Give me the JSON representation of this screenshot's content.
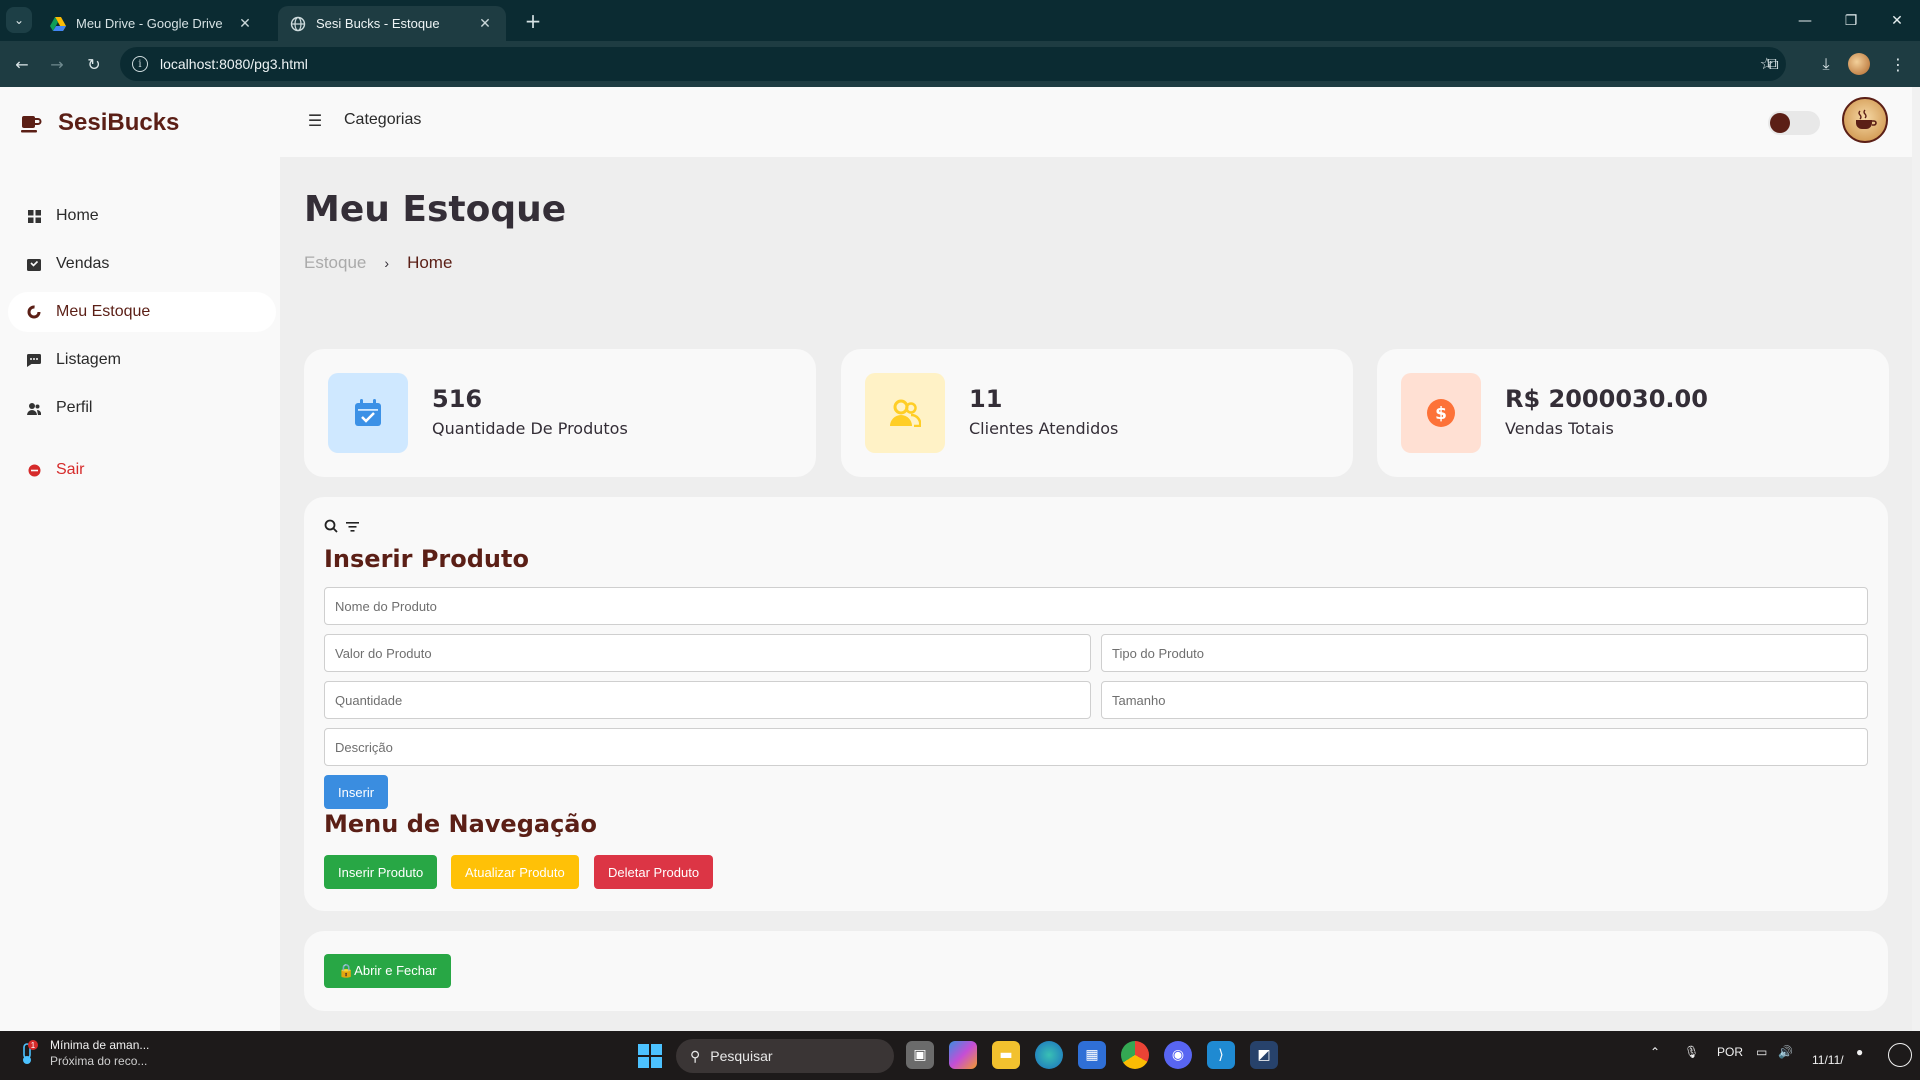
{
  "browser": {
    "tabs": [
      {
        "title": "Meu Drive - Google Drive",
        "active": false
      },
      {
        "title": "Sesi Bucks - Estoque",
        "active": true
      }
    ],
    "url": "localhost:8080/pg3.html"
  },
  "brand": {
    "name": "SesiBucks"
  },
  "sidebar": {
    "items": [
      {
        "label": "Home",
        "icon": "dashboard-icon"
      },
      {
        "label": "Vendas",
        "icon": "shopping-bag-icon"
      },
      {
        "label": "Meu Estoque",
        "icon": "doughnut-chart-icon",
        "active": true
      },
      {
        "label": "Listagem",
        "icon": "message-dots-icon"
      },
      {
        "label": "Perfil",
        "icon": "group-icon"
      }
    ],
    "logout": {
      "label": "Sair",
      "icon": "logout-circle-icon"
    }
  },
  "topbar": {
    "menu_icon": "menu-icon",
    "category_label": "Categorias",
    "theme_toggle_on": true
  },
  "main": {
    "title": "Meu Estoque",
    "breadcrumb": [
      "Estoque",
      "Home"
    ]
  },
  "stats": [
    {
      "value": "516",
      "label": "Quantidade De Produtos",
      "icon": "calendar-check-icon",
      "color": "#3c91e6",
      "bg": "#cfe8ff"
    },
    {
      "value": "11",
      "label": "Clientes Atendidos",
      "icon": "group-icon",
      "color": "#ffce26",
      "bg": "#fff2c6"
    },
    {
      "value": "R$ 2000030.00",
      "label": "Vendas Totais",
      "icon": "dollar-circle-icon",
      "color": "#fd7238",
      "bg": "#ffe0d3"
    }
  ],
  "form": {
    "heading": "Inserir Produto",
    "fields": {
      "nome": {
        "placeholder": "Nome do Produto",
        "value": ""
      },
      "valor": {
        "placeholder": "Valor do Produto",
        "value": ""
      },
      "tipo": {
        "placeholder": "Tipo do Produto",
        "value": ""
      },
      "quantidade": {
        "placeholder": "Quantidade",
        "value": ""
      },
      "tamanho": {
        "placeholder": "Tamanho",
        "value": ""
      },
      "descricao": {
        "placeholder": "Descrição",
        "value": ""
      }
    },
    "submit_label": "Inserir"
  },
  "nav_menu": {
    "heading": "Menu de Navegação",
    "buttons": [
      "Inserir Produto",
      "Atualizar Produto",
      "Deletar Produto"
    ]
  },
  "toggle_panel": {
    "button_label": "🔒Abrir e Fechar"
  },
  "taskbar": {
    "weather_title": "Mínima de aman...",
    "weather_sub": "Próxima do reco...",
    "weather_badge": "1",
    "search_label": "Pesquisar",
    "language": "POR",
    "date": "11/11/"
  },
  "colors": {
    "brand": "#5b1f16",
    "accent_blue": "#3c91e6",
    "dark_text": "#342e37",
    "light_bg": "#eeeeee"
  }
}
